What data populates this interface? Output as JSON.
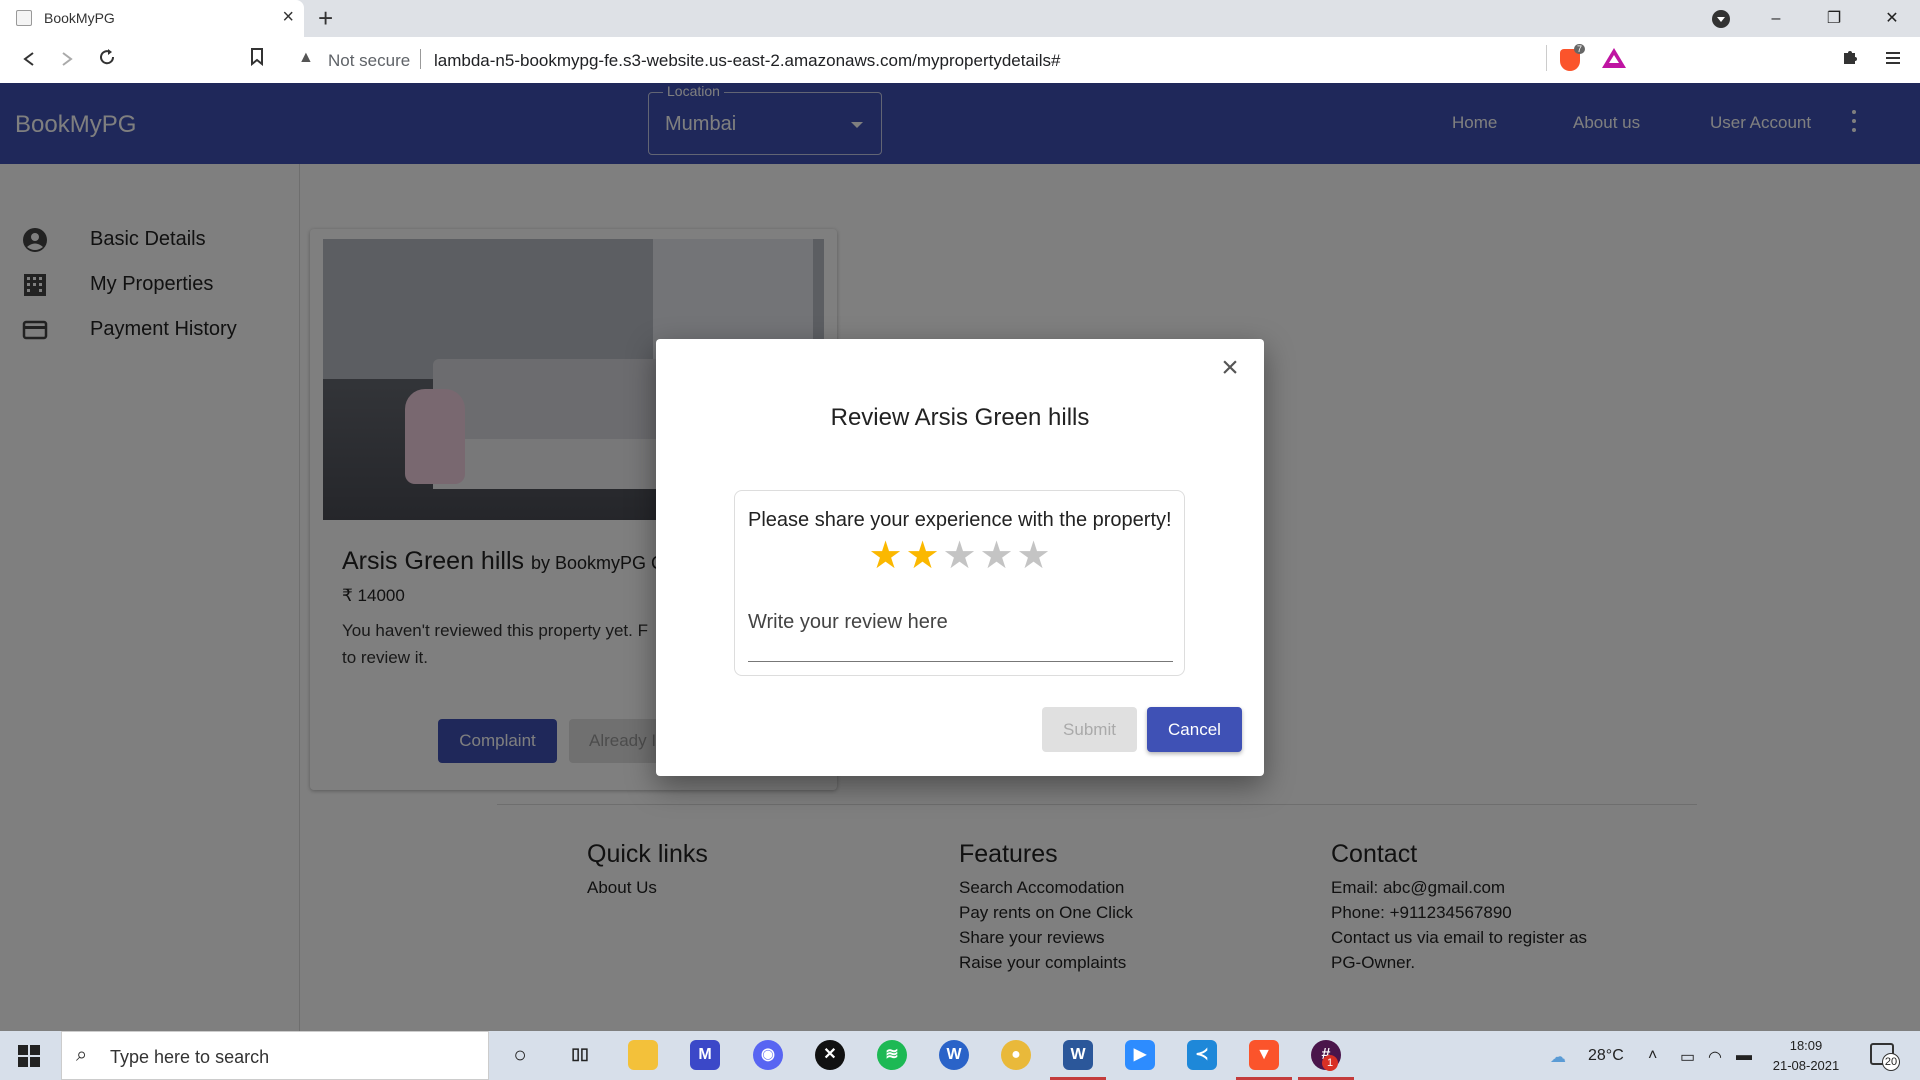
{
  "browser": {
    "tab_title": "BookMyPG",
    "tab_close": "×",
    "new_tab": "+",
    "security_label": "Not secure",
    "url": "lambda-n5-bookmypg-fe.s3-website.us-east-2.amazonaws.com/mypropertydetails#",
    "brave_badge": "7",
    "window_controls": [
      "–",
      "❐",
      "✕"
    ]
  },
  "app": {
    "brand": "BookMyPG",
    "location": {
      "label": "Location",
      "value": "Mumbai"
    },
    "nav": [
      {
        "label": "Home"
      },
      {
        "label": "About us"
      },
      {
        "label": "User Account"
      }
    ]
  },
  "sidebar": {
    "items": [
      {
        "label": "Basic Details",
        "icon": "account-circle-icon"
      },
      {
        "label": "My Properties",
        "icon": "building-icon"
      },
      {
        "label": "Payment History",
        "icon": "credit-card-icon"
      }
    ]
  },
  "property_card": {
    "title": "Arsis Green hills",
    "owner": "by BookmyPG C",
    "price": "₹ 14000",
    "message": "You haven't reviewed this property yet. F to review it.",
    "complaint_button": "Complaint",
    "already_button": "Already I"
  },
  "footer": {
    "quick_links": {
      "heading": "Quick links",
      "items": [
        "About Us"
      ]
    },
    "features": {
      "heading": "Features",
      "items": [
        "Search Accomodation",
        "Pay rents on One Click",
        "Share your reviews",
        "Raise your complaints"
      ]
    },
    "contact": {
      "heading": "Contact",
      "items": [
        "Email: abc@gmail.com",
        "Phone: +911234567890",
        "Contact us via email to register as",
        "PG-Owner."
      ]
    }
  },
  "dialog": {
    "title": "Review Arsis Green hills",
    "prompt": "Please share your experience with the property!",
    "rating": 2,
    "rating_max": 5,
    "review_placeholder": "Write your review here",
    "submit_label": "Submit",
    "cancel_label": "Cancel",
    "close_symbol": "×"
  },
  "taskbar": {
    "search_placeholder": "Type here to search",
    "weather": "28°C",
    "time": "18:09",
    "date": "21-08-2021",
    "notification_count": "20",
    "slack_badge": "1"
  },
  "colors": {
    "primary": "#3f51b5",
    "star_on": "#fbb800",
    "star_off": "#c4c4c4"
  }
}
